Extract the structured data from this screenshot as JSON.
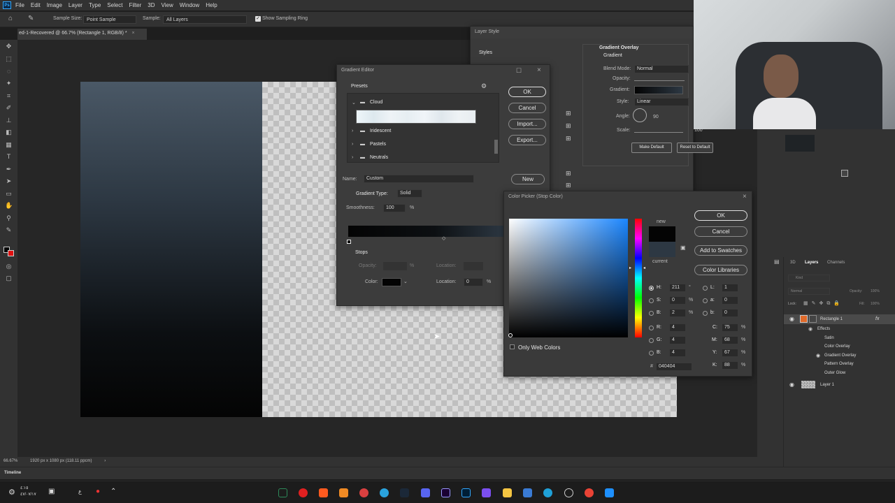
{
  "app": {
    "logo": "Ps",
    "doc_tab": "ed-1-Recovered @ 66.7% (Rectangle 1, RGB/8) *",
    "close_glyph": "×"
  },
  "menu": [
    "File",
    "Edit",
    "Image",
    "Layer",
    "Type",
    "Select",
    "Filter",
    "3D",
    "View",
    "Window",
    "Help"
  ],
  "options": {
    "sample_size_label": "Sample Size:",
    "sample_size_value": "Point Sample",
    "sample_label": "Sample:",
    "sample_value": "All Layers",
    "show_ring_label": "Show Sampling Ring",
    "show_ring_checked": true
  },
  "status": {
    "zoom": "66.67%",
    "doc_size": "1920 px x 1080 px (118.11 ppcm)"
  },
  "timeline": {
    "label": "Timeline"
  },
  "gradient_editor": {
    "title": "Gradient Editor",
    "presets_label": "Presets",
    "folders": [
      "Cloud",
      "Iridescent",
      "Pastels",
      "Neutrals"
    ],
    "name_label": "Name:",
    "name_value": "Custom",
    "gradient_type_label": "Gradient Type:",
    "gradient_type_value": "Solid",
    "smoothness_label": "Smoothness:",
    "smoothness_value": "100",
    "smoothness_unit": "%",
    "stops_label": "Stops",
    "opacity_label": "Opacity:",
    "opacity_unit": "%",
    "location_label": "Location:",
    "location_unit": "%",
    "color_label": "Color:",
    "color_location_value": "0",
    "buttons": {
      "ok": "OK",
      "cancel": "Cancel",
      "import": "Import...",
      "export": "Export...",
      "new": "New"
    }
  },
  "color_picker": {
    "title": "Color Picker (Stop Color)",
    "new_label": "new",
    "current_label": "current",
    "only_web_label": "Only Web Colors",
    "buttons": {
      "ok": "OK",
      "cancel": "Cancel",
      "add_swatches": "Add to Swatches",
      "libraries": "Color Libraries"
    },
    "hsb": [
      {
        "label": "H:",
        "value": "211",
        "unit": "°"
      },
      {
        "label": "S:",
        "value": "0",
        "unit": "%"
      },
      {
        "label": "B:",
        "value": "2",
        "unit": "%"
      }
    ],
    "rgb": [
      {
        "label": "R:",
        "value": "4"
      },
      {
        "label": "G:",
        "value": "4"
      },
      {
        "label": "B:",
        "value": "4"
      }
    ],
    "lab": [
      {
        "label": "L:",
        "value": "1"
      },
      {
        "label": "a:",
        "value": "0"
      },
      {
        "label": "b:",
        "value": "0"
      }
    ],
    "cmyk": [
      {
        "label": "C:",
        "value": "75",
        "unit": "%"
      },
      {
        "label": "M:",
        "value": "68",
        "unit": "%"
      },
      {
        "label": "Y:",
        "value": "67",
        "unit": "%"
      },
      {
        "label": "K:",
        "value": "88",
        "unit": "%"
      }
    ],
    "hex_label": "#",
    "hex_value": "040404",
    "new_color": "#040404",
    "current_color": "#2d3843"
  },
  "layer_style": {
    "title": "Layer Style",
    "styles_label": "Styles",
    "section_title": "Gradient Overlay",
    "subsection": "Gradient",
    "blend_mode_label": "Blend Mode:",
    "blend_mode_value": "Normal",
    "opacity_label": "Opacity:",
    "gradient_label": "Gradient:",
    "style_label": "Style:",
    "style_value": "Linear",
    "angle_label": "Angle:",
    "angle_value": "90",
    "scale_label": "Scale:",
    "scale_value": "100",
    "make_default": "Make Default",
    "reset_default": "Reset to Default"
  },
  "layers_panel": {
    "tabs": [
      "3D",
      "Layers",
      "Channels"
    ],
    "kind_label": "Kind",
    "blend_value": "Normal",
    "opacity_label": "Opacity:",
    "opacity_value": "100%",
    "lock_label": "Lock:",
    "fill_label": "Fill:",
    "fill_value": "100%",
    "fx_label": "fx",
    "layers": [
      {
        "name": "Rectangle 1",
        "type": "layer",
        "selected": true
      },
      {
        "name": "Effects",
        "type": "effects-header"
      },
      {
        "name": "Satin",
        "type": "effect"
      },
      {
        "name": "Color Overlay",
        "type": "effect"
      },
      {
        "name": "Gradient Overlay",
        "type": "effect",
        "visible": true
      },
      {
        "name": "Pattern Overlay",
        "type": "effect"
      },
      {
        "name": "Outer Glow",
        "type": "effect"
      },
      {
        "name": "Layer 1",
        "type": "layer"
      }
    ]
  },
  "taskbar": {
    "clock_time": "٤:١٥",
    "clock_date": "٤٧/٠٧/١٧"
  }
}
